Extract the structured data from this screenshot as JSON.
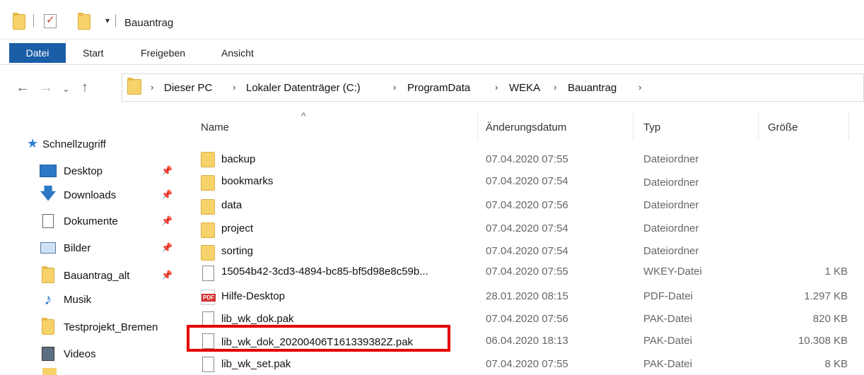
{
  "window": {
    "title": "Bauantrag"
  },
  "ribbon": {
    "tabs": [
      "Datei",
      "Start",
      "Freigeben",
      "Ansicht"
    ]
  },
  "address": {
    "crumbs": [
      "Dieser PC",
      "Lokaler Datenträger (C:)",
      "ProgramData",
      "WEKA",
      "Bauantrag"
    ]
  },
  "nav": {
    "quick_access": "Schnellzugriff",
    "items": [
      {
        "label": "Desktop",
        "icon": "desktop-icon",
        "pinned": true
      },
      {
        "label": "Downloads",
        "icon": "download-arrow-icon",
        "pinned": true
      },
      {
        "label": "Dokumente",
        "icon": "documents-icon",
        "pinned": true
      },
      {
        "label": "Bilder",
        "icon": "pictures-icon",
        "pinned": true
      },
      {
        "label": "Bauantrag_alt",
        "icon": "folder-icon",
        "pinned": true
      },
      {
        "label": "Musik",
        "icon": "music-note-icon",
        "pinned": false
      },
      {
        "label": "Testprojekt_Bremen",
        "icon": "folder-icon",
        "pinned": false
      },
      {
        "label": "Videos",
        "icon": "videos-icon",
        "pinned": false
      }
    ]
  },
  "columns": {
    "name": "Name",
    "date": "Änderungsdatum",
    "type": "Typ",
    "size": "Größe"
  },
  "files": [
    {
      "name": "backup",
      "date": "07.04.2020 07:55",
      "type": "Dateiordner",
      "size": "",
      "icon": "folder-icon"
    },
    {
      "name": "bookmarks",
      "date": "07.04.2020 07:54",
      "type": "Dateiordner",
      "size": "",
      "icon": "folder-icon"
    },
    {
      "name": "data",
      "date": "07.04.2020 07:56",
      "type": "Dateiordner",
      "size": "",
      "icon": "folder-icon"
    },
    {
      "name": "project",
      "date": "07.04.2020 07:54",
      "type": "Dateiordner",
      "size": "",
      "icon": "folder-icon"
    },
    {
      "name": "sorting",
      "date": "07.04.2020 07:54",
      "type": "Dateiordner",
      "size": "",
      "icon": "folder-icon"
    },
    {
      "name": "15054b42-3cd3-4894-bc85-bf5d98e8c59b...",
      "date": "07.04.2020 07:55",
      "type": "WKEY-Datei",
      "size": "1 KB",
      "icon": "file-icon"
    },
    {
      "name": "Hilfe-Desktop",
      "date": "28.01.2020 08:15",
      "type": "PDF-Datei",
      "size": "1.297 KB",
      "icon": "pdf-icon"
    },
    {
      "name": "lib_wk_dok.pak",
      "date": "07.04.2020 07:56",
      "type": "PAK-Datei",
      "size": "820 KB",
      "icon": "file-icon"
    },
    {
      "name": "lib_wk_dok_20200406T161339382Z.pak",
      "date": "06.04.2020 18:13",
      "type": "PAK-Datei",
      "size": "10.308 KB",
      "icon": "file-icon"
    },
    {
      "name": "lib_wk_set.pak",
      "date": "07.04.2020 07:55",
      "type": "PAK-Datei",
      "size": "8 KB",
      "icon": "file-icon"
    }
  ],
  "colors": {
    "accent": "#1a5ea8",
    "highlight": "#e50000",
    "folder": "#f7d26b"
  }
}
